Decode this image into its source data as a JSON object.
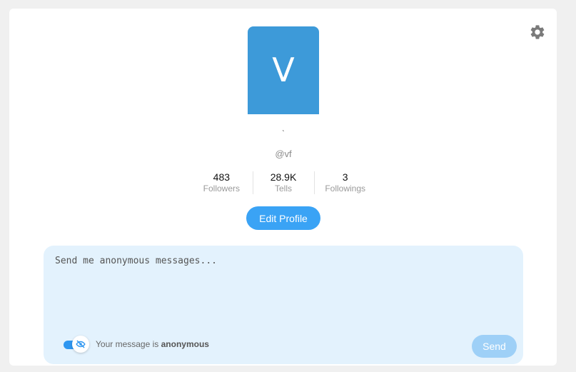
{
  "profile": {
    "avatar_initial": "V",
    "display_name": "ˎ",
    "handle": "@vf",
    "avatar_color": "#3d9ad9"
  },
  "stats": [
    {
      "value": "483",
      "label": "Followers"
    },
    {
      "value": "28.9K",
      "label": "Tells"
    },
    {
      "value": "3",
      "label": "Followings"
    }
  ],
  "actions": {
    "edit_profile_label": "Edit Profile",
    "settings_icon": "gear-icon"
  },
  "composer": {
    "placeholder": "Send me anonymous messages...",
    "value": "",
    "anonymous_prefix": "Your message is ",
    "anonymous_state": "anonymous",
    "anonymous_toggle_on": true,
    "toggle_icon": "eye-off-icon",
    "send_label": "Send"
  },
  "colors": {
    "accent": "#3aa3f5",
    "send_disabled": "#9ed0f7",
    "composer_bg": "#e3f2fd"
  }
}
